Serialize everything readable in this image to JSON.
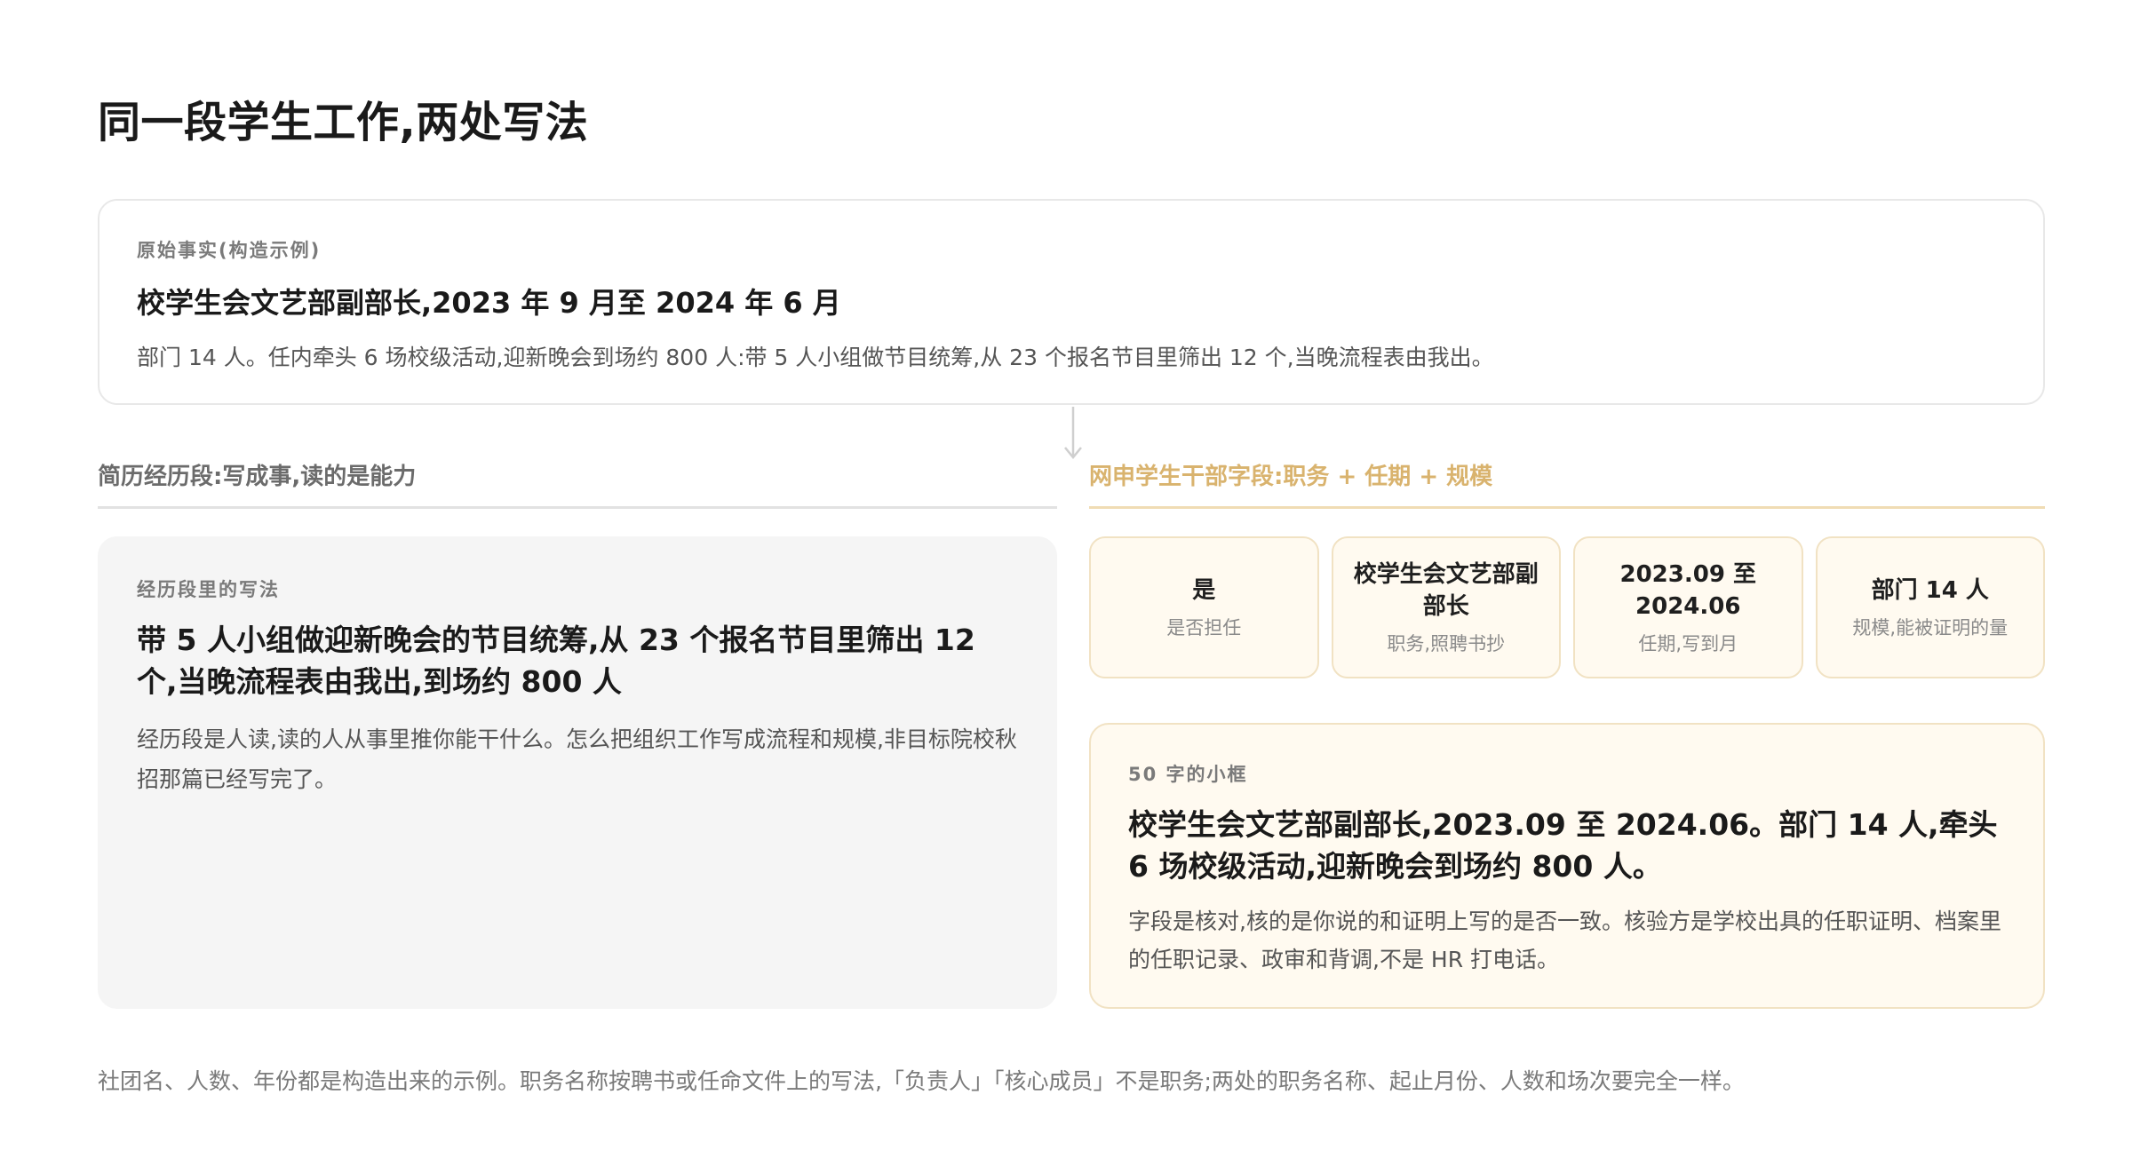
{
  "page": {
    "title": "同一段学生工作,两处写法",
    "footnote": "社团名、人数、年份都是构造出来的示例。职务名称按聘书或任命文件上的写法,「负责人」「核心成员」不是职务;两处的职务名称、起止月份、人数和场次要完全一样。"
  },
  "source": {
    "eyebrow": "原始事实(构造示例)",
    "headline": "校学生会文艺部副部长,2023 年 9 月至 2024 年 6 月",
    "body": "部门 14 人。任内牵头 6 场校级活动,迎新晚会到场约 800 人:带 5 人小组做节目统筹,从 23 个报名节目里筛出 12 个,当晚流程表由我出。"
  },
  "resume": {
    "section_label": "简历经历段:写成事,读的是能力",
    "eyebrow": "经历段里的写法",
    "headline": "带 5 人小组做迎新晚会的节目统筹,从 23 个报名节目里筛出 12 个,当晚流程表由我出,到场约 800 人",
    "body": "经历段是人读,读的人从事里推你能干什么。怎么把组织工作写成流程和规模,非目标院校秋招那篇已经写完了。"
  },
  "application": {
    "section_label": "网申学生干部字段:职务 + 任期 + 规模",
    "fields": [
      {
        "value": "是",
        "note": "是否担任"
      },
      {
        "value": "校学生会文艺部副部长",
        "note": "职务,照聘书抄"
      },
      {
        "value": "2023.09 至 2024.06",
        "note": "任期,写到月"
      },
      {
        "value": "部门 14 人",
        "note": "规模,能被证明的量"
      }
    ],
    "short_box": {
      "eyebrow": "50 字的小框",
      "headline": "校学生会文艺部副部长,2023.09 至 2024.06。部门 14 人,牵头 6 场校级活动,迎新晚会到场约 800 人。",
      "body": "字段是核对,核的是你说的和证明上写的是否一致。核验方是学校出具的任职证明、档案里的任职记录、政审和背调,不是 HR 打电话。"
    }
  },
  "colors": {
    "accent_gold": "#d9b36e",
    "card_cream": "#fffaf0",
    "card_gray": "#f5f5f5"
  }
}
